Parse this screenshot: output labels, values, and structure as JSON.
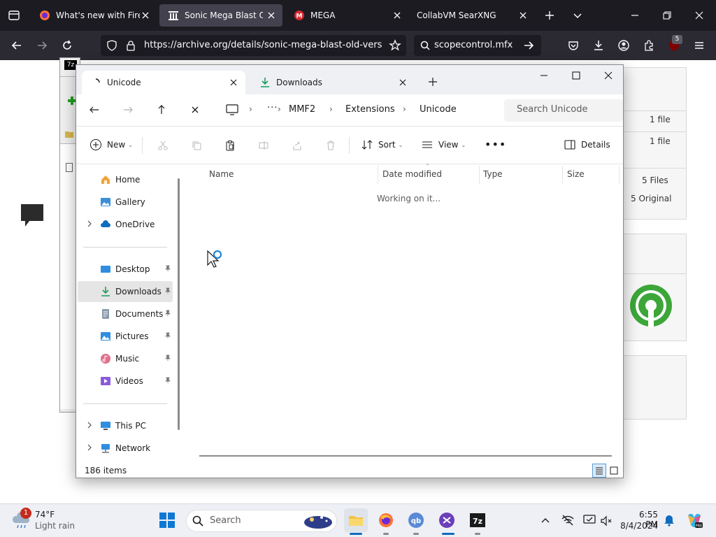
{
  "browser": {
    "tabs": [
      {
        "title": "What's new with Firefox",
        "favicon": "firefox-icon",
        "active": false
      },
      {
        "title": "Sonic Mega Blast Old Versions",
        "favicon": "archive-icon",
        "active": true
      },
      {
        "title": "MEGA",
        "favicon": "mega-icon",
        "active": false
      },
      {
        "title": "CollabVM SearXNG",
        "favicon": "none",
        "active": false
      }
    ],
    "url": "https://archive.org/details/sonic-mega-blast-old-versions",
    "search_text": "scopecontrol.mfx",
    "extension_badge": "5"
  },
  "background_page": {
    "rows": [
      "1 file",
      "1 file",
      "5 Files",
      "5 Original"
    ]
  },
  "explorer": {
    "tabs": [
      {
        "title": "Unicode",
        "active": true
      },
      {
        "title": "Downloads",
        "active": false
      }
    ],
    "breadcrumbs": [
      "MMF2",
      "Extensions",
      "Unicode"
    ],
    "search_placeholder": "Search Unicode",
    "commands": {
      "new": "New",
      "sort": "Sort",
      "view": "View",
      "details": "Details"
    },
    "nav": {
      "home": "Home",
      "gallery": "Gallery",
      "onedrive": "OneDrive",
      "desktop": "Desktop",
      "downloads": "Downloads",
      "documents": "Documents",
      "pictures": "Pictures",
      "music": "Music",
      "videos": "Videos",
      "thispc": "This PC",
      "network": "Network"
    },
    "columns": [
      "Name",
      "Date modified",
      "Type",
      "Size"
    ],
    "working_text": "Working on it...",
    "status_count": "186 items"
  },
  "taskbar": {
    "weather_temp": "74°F",
    "weather_desc": "Light rain",
    "weather_badge": "1",
    "search_label": "Search",
    "time": "6:55 PM",
    "date": "8/4/2024"
  }
}
